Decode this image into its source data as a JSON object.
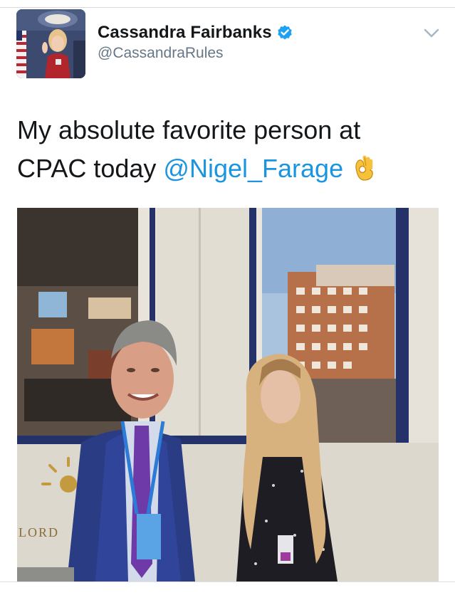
{
  "tweet": {
    "author": {
      "display_name": "Cassandra Fairbanks",
      "handle": "@CassandraRules",
      "verified": true,
      "avatar_icon": "profile-photo"
    },
    "text_line1": "My absolute favorite person at",
    "text_line2_prefix": "CPAC today ",
    "mention": "@Nigel_Farage",
    "emoji": "ok-hand-emoji",
    "media": {
      "type": "photo",
      "sign_text": "LORD"
    },
    "menu_icon": "chevron-down-icon"
  },
  "colors": {
    "link": "#1b95e0",
    "verified_badge": "#1da1f2",
    "handle_gray": "#657786",
    "text": "#14171a"
  }
}
